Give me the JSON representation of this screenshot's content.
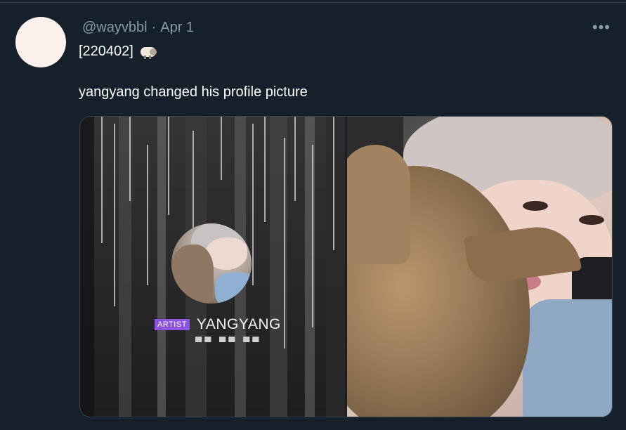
{
  "tweet": {
    "handle": "@wayvbbl",
    "separator": "·",
    "date": "Apr 1",
    "more_label": "•••",
    "line1_text": "[220402]",
    "line1_emoji": "sheep-emoji",
    "line2_text": "yangyang changed his profile picture"
  },
  "media": {
    "left_image": {
      "badge": "ARTIST",
      "name": "YANGYANG",
      "sub": "▀▀ ▀▀ ▀▀"
    },
    "right_image": {}
  },
  "colors": {
    "background": "#15202b",
    "secondary_text": "#8899a6",
    "primary_text": "#ffffff",
    "badge": "#8c52e0",
    "avatar": "#fbf0ec"
  }
}
